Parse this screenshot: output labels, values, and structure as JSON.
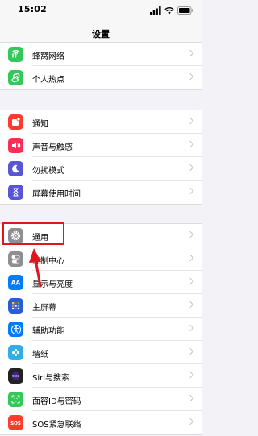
{
  "status_bar": {
    "time": "15:02"
  },
  "nav": {
    "title": "设置"
  },
  "groups": [
    {
      "items": [
        {
          "label": "蜂窝网络",
          "icon": "cellular-icon",
          "color": "#34c759"
        },
        {
          "label": "个人热点",
          "icon": "hotspot-icon",
          "color": "#34c759"
        }
      ]
    },
    {
      "items": [
        {
          "label": "通知",
          "icon": "notifications-icon",
          "color": "#ff3b30"
        },
        {
          "label": "声音与触感",
          "icon": "sounds-icon",
          "color": "#ff2d55"
        },
        {
          "label": "勿扰模式",
          "icon": "moon-icon",
          "color": "#5856d6"
        },
        {
          "label": "屏幕使用时间",
          "icon": "hourglass-icon",
          "color": "#5856d6"
        }
      ]
    },
    {
      "items": [
        {
          "label": "通用",
          "icon": "gear-icon",
          "color": "#8e8e93"
        },
        {
          "label": "控制中心",
          "icon": "toggles-icon",
          "color": "#8e8e93"
        },
        {
          "label": "显示与亮度",
          "icon": "display-icon",
          "color": "#007aff"
        },
        {
          "label": "主屏幕",
          "icon": "home-screen-icon",
          "color": "#2c5bd9"
        },
        {
          "label": "辅助功能",
          "icon": "accessibility-icon",
          "color": "#007aff"
        },
        {
          "label": "墙纸",
          "icon": "wallpaper-icon",
          "color": "#32ade6"
        },
        {
          "label": "Siri与搜索",
          "icon": "siri-icon",
          "color": "#222222"
        },
        {
          "label": "面容ID与密码",
          "icon": "faceid-icon",
          "color": "#34c759"
        },
        {
          "label": "SOS紧急联络",
          "icon": "sos-icon",
          "color": "#ff3b30"
        }
      ]
    }
  ],
  "annotation": {
    "highlight_color": "#e0161d"
  }
}
